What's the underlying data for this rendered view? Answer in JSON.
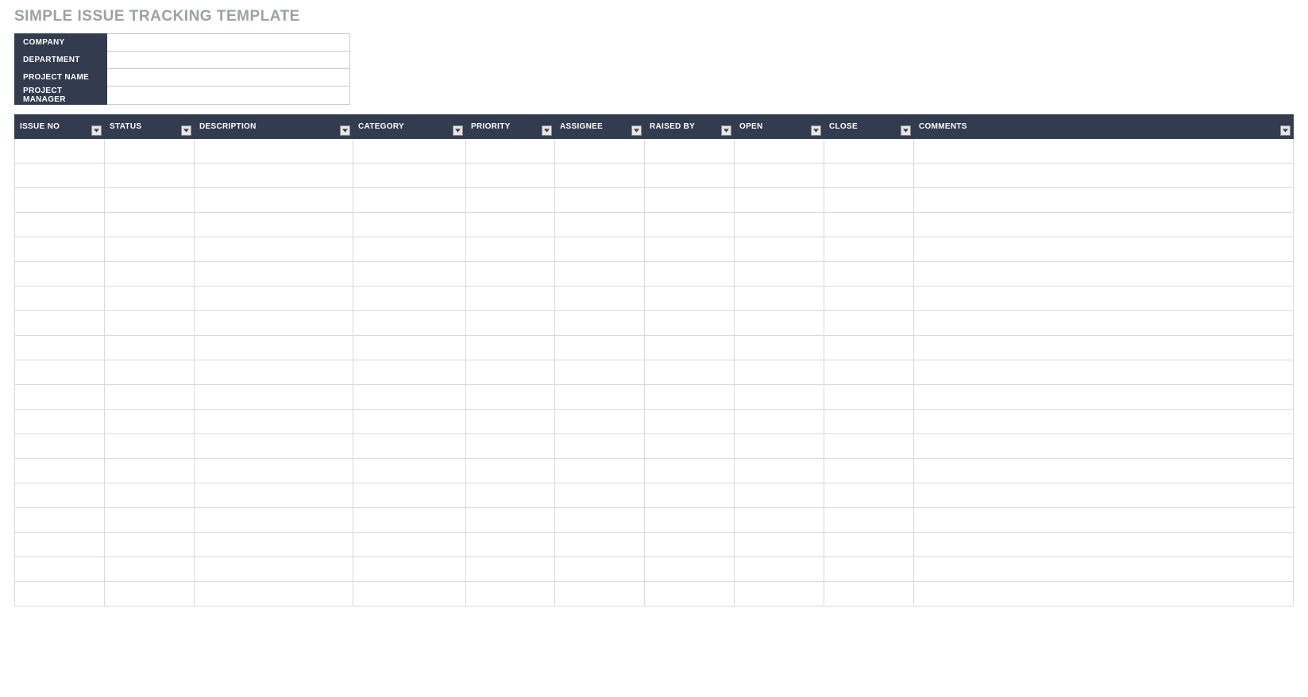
{
  "title": "SIMPLE ISSUE TRACKING TEMPLATE",
  "meta": {
    "rows": [
      {
        "label": "COMPANY",
        "value": ""
      },
      {
        "label": "DEPARTMENT",
        "value": ""
      },
      {
        "label": "PROJECT NAME",
        "value": ""
      },
      {
        "label": "PROJECT MANAGER",
        "value": ""
      }
    ]
  },
  "table": {
    "columns": [
      "ISSUE NO",
      "STATUS",
      "DESCRIPTION",
      "CATEGORY",
      "PRIORITY",
      "ASSIGNEE",
      "RAISED BY",
      "OPEN",
      "CLOSE",
      "COMMENTS"
    ],
    "rows": [
      [
        "",
        "",
        "",
        "",
        "",
        "",
        "",
        "",
        "",
        ""
      ],
      [
        "",
        "",
        "",
        "",
        "",
        "",
        "",
        "",
        "",
        ""
      ],
      [
        "",
        "",
        "",
        "",
        "",
        "",
        "",
        "",
        "",
        ""
      ],
      [
        "",
        "",
        "",
        "",
        "",
        "",
        "",
        "",
        "",
        ""
      ],
      [
        "",
        "",
        "",
        "",
        "",
        "",
        "",
        "",
        "",
        ""
      ],
      [
        "",
        "",
        "",
        "",
        "",
        "",
        "",
        "",
        "",
        ""
      ],
      [
        "",
        "",
        "",
        "",
        "",
        "",
        "",
        "",
        "",
        ""
      ],
      [
        "",
        "",
        "",
        "",
        "",
        "",
        "",
        "",
        "",
        ""
      ],
      [
        "",
        "",
        "",
        "",
        "",
        "",
        "",
        "",
        "",
        ""
      ],
      [
        "",
        "",
        "",
        "",
        "",
        "",
        "",
        "",
        "",
        ""
      ],
      [
        "",
        "",
        "",
        "",
        "",
        "",
        "",
        "",
        "",
        ""
      ],
      [
        "",
        "",
        "",
        "",
        "",
        "",
        "",
        "",
        "",
        ""
      ],
      [
        "",
        "",
        "",
        "",
        "",
        "",
        "",
        "",
        "",
        ""
      ],
      [
        "",
        "",
        "",
        "",
        "",
        "",
        "",
        "",
        "",
        ""
      ],
      [
        "",
        "",
        "",
        "",
        "",
        "",
        "",
        "",
        "",
        ""
      ],
      [
        "",
        "",
        "",
        "",
        "",
        "",
        "",
        "",
        "",
        ""
      ],
      [
        "",
        "",
        "",
        "",
        "",
        "",
        "",
        "",
        "",
        ""
      ],
      [
        "",
        "",
        "",
        "",
        "",
        "",
        "",
        "",
        "",
        ""
      ],
      [
        "",
        "",
        "",
        "",
        "",
        "",
        "",
        "",
        "",
        ""
      ]
    ]
  }
}
